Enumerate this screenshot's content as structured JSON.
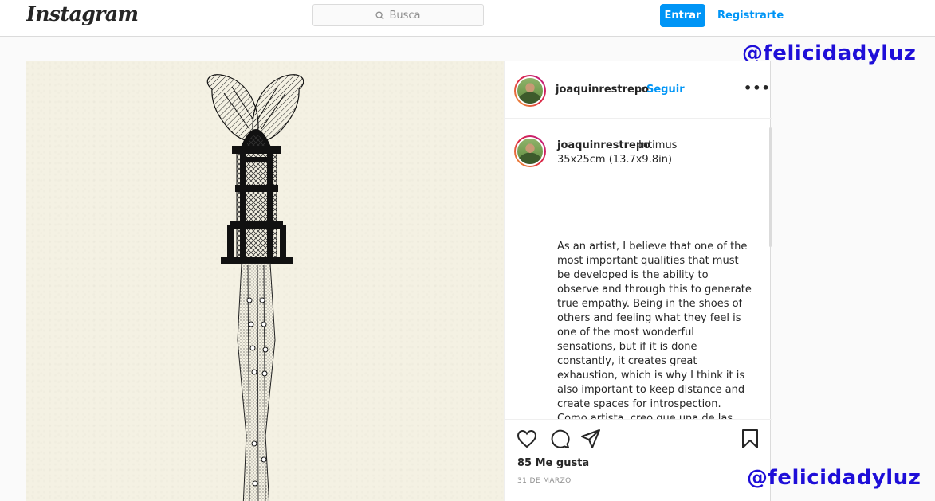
{
  "header": {
    "logo": "Instagram",
    "search_placeholder": "Busca",
    "login_label": "Entrar",
    "signup_label": "Registrarte"
  },
  "watermark": {
    "top": "@felicidadyluz",
    "bottom": "@felicidadyluz"
  },
  "post": {
    "author": "joaquinrestrepo",
    "separator": "•",
    "follow_label": "Seguir",
    "more_label": "•••",
    "caption": {
      "author": "joaquinrestrepo",
      "title": "Intimus",
      "size": "35x25cm (13.7x9.8in)",
      "paragraph_en": "As an artist, I believe that one of the most important qualities that must be developed is the ability to observe and through this to generate true empathy. Being in the shoes of others and feeling what they feel is one of the most wonderful sensations, but if it is done constantly, it creates great exhaustion, which is why I think it is also important to keep distance and create spaces for introspection.",
      "paragraph_es": "Como artista, creo que una de las cualidades más importantes que se debe desarrollar es la capacidad de observar y a través de está poder generar una verdadera empatía. Estar"
    },
    "likes": "85 Me gusta",
    "date": "31 DE MARZO"
  },
  "icons": {
    "search": "search-icon",
    "heart": "heart-icon",
    "comment": "comment-icon",
    "share": "share-icon",
    "save": "bookmark-icon",
    "more": "more-options-icon"
  },
  "colors": {
    "accent": "#0095f6",
    "watermark": "#1e0ed8",
    "border": "#dbdbdb"
  }
}
